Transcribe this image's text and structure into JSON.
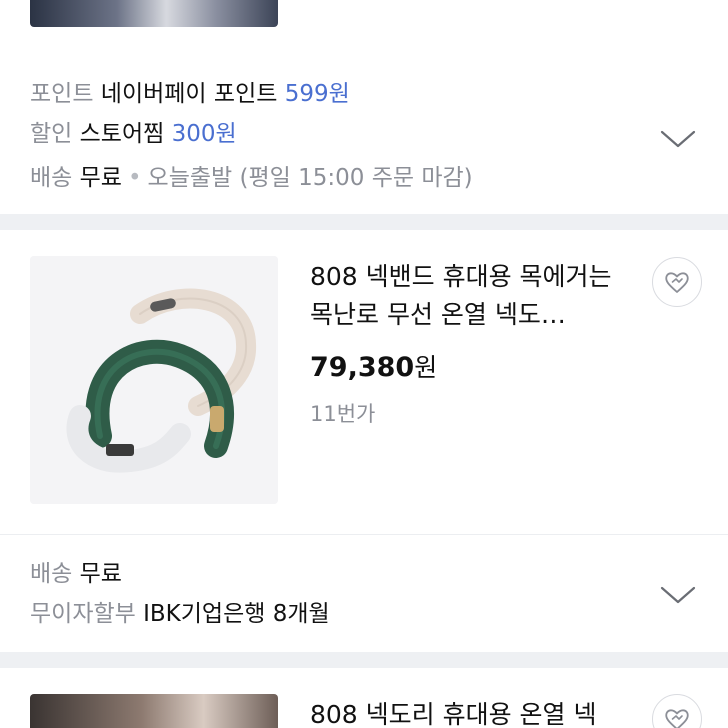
{
  "product_prev": {
    "point_label": "포인트",
    "point_value_text": "네이버페이 포인트",
    "point_amount": "599원",
    "discount_label": "할인",
    "discount_text": "스토어찜",
    "discount_amount": "300원",
    "shipping_label": "배송",
    "shipping_value": "무료",
    "shipping_extra": "오늘출발 (평일 15:00 주문 마감)"
  },
  "product_1": {
    "title": "808 넥밴드 휴대용 목에거는 목난로 무선 온열 넥도…",
    "price_number": "79,380",
    "price_unit": "원",
    "seller": "11번가",
    "shipping_label": "배송",
    "shipping_value": "무료",
    "installment_label": "무이자할부",
    "installment_bank": "IBK기업은행",
    "installment_months": "8개월"
  },
  "product_2": {
    "title": "808 넥도리 휴대용 온열 넥"
  },
  "icons": {
    "expand": "chevron-down-icon",
    "wishlist": "heart-icon"
  },
  "colors": {
    "accent_blue": "#4a6fd0",
    "muted_text": "#8c8f97",
    "divider": "#eef0f3"
  }
}
